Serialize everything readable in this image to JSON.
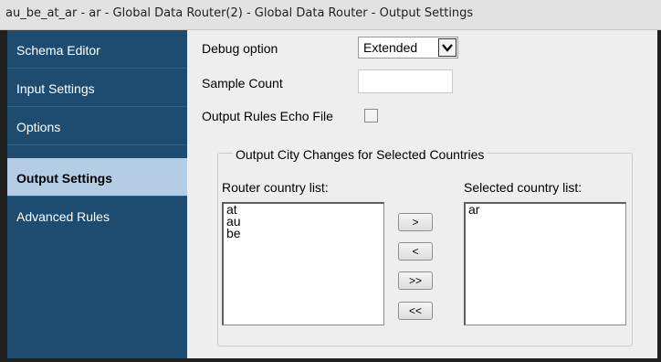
{
  "window": {
    "title": "au_be_at_ar - ar - Global Data Router(2) - Global Data Router - Output Settings"
  },
  "sidebar": {
    "items": [
      {
        "label": "Schema Editor"
      },
      {
        "label": "Input Settings"
      },
      {
        "label": "Options"
      },
      {
        "label": "Output Settings",
        "active": true
      },
      {
        "label": "Advanced Rules"
      }
    ]
  },
  "form": {
    "debug_option": {
      "label": "Debug option",
      "value": "Extended"
    },
    "sample_count": {
      "label": "Sample Count",
      "value": ""
    },
    "echo_file": {
      "label": "Output Rules Echo File",
      "checked": false
    }
  },
  "group": {
    "title": "Output City Changes for Selected Countries",
    "router_list": {
      "label": "Router country list:",
      "items": [
        "at",
        "au",
        "be"
      ]
    },
    "selected_list": {
      "label": "Selected country list:",
      "items": [
        "ar"
      ]
    },
    "buttons": {
      "add": ">",
      "remove": "<",
      "add_all": ">>",
      "remove_all": "<<"
    }
  },
  "colors": {
    "sidebar_bg": "#1e4c70",
    "sidebar_active": "#b4cde5",
    "panel_bg": "#eeeeee"
  }
}
